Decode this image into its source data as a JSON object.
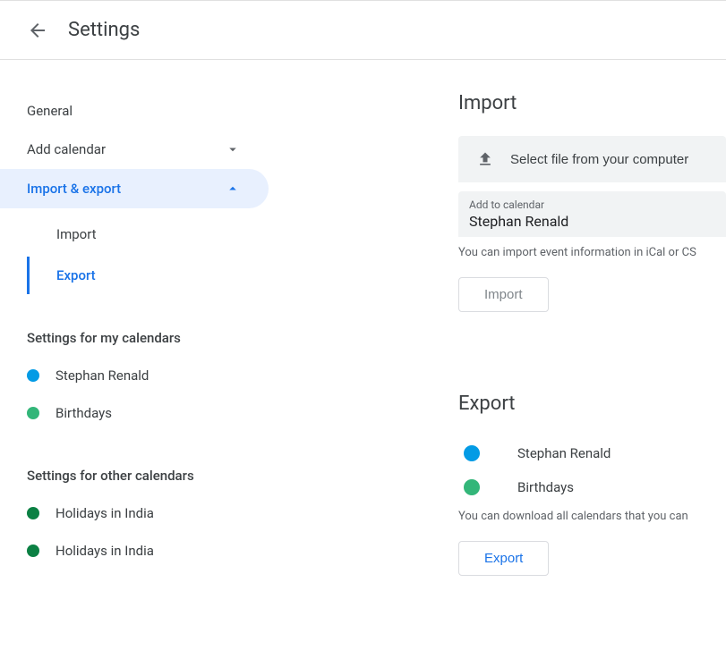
{
  "header": {
    "title": "Settings"
  },
  "sidebar": {
    "general": "General",
    "add_calendar": "Add calendar",
    "import_export": "Import & export",
    "sub_import": "Import",
    "sub_export": "Export",
    "my_calendars_header": "Settings for my calendars",
    "my_calendars": [
      {
        "label": "Stephan Renald",
        "color": "#039be5"
      },
      {
        "label": "Birthdays",
        "color": "#33b679"
      }
    ],
    "other_calendars_header": "Settings for other calendars",
    "other_calendars": [
      {
        "label": "Holidays in India",
        "color": "#0b8043"
      },
      {
        "label": "Holidays in India",
        "color": "#0b8043"
      }
    ]
  },
  "import_section": {
    "title": "Import",
    "file_select_label": "Select file from your computer",
    "add_to_calendar_label": "Add to calendar",
    "selected_calendar": "Stephan Renald",
    "hint": "You can import event information in iCal or CS",
    "button": "Import"
  },
  "export_section": {
    "title": "Export",
    "calendars": [
      {
        "label": "Stephan Renald",
        "color": "#039be5"
      },
      {
        "label": "Birthdays",
        "color": "#33b679"
      }
    ],
    "hint": "You can download all calendars that you can ",
    "button": "Export"
  }
}
